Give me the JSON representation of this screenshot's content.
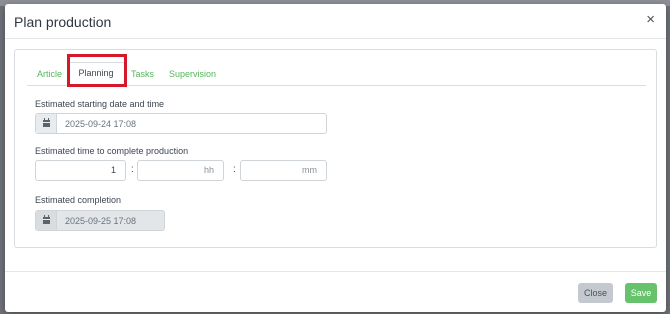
{
  "modal": {
    "title": "Plan production",
    "close_glyph": "×"
  },
  "tabs": [
    {
      "label": "Article",
      "active": false
    },
    {
      "label": "Planning",
      "active": true
    },
    {
      "label": "Tasks",
      "active": false
    },
    {
      "label": "Supervision",
      "active": false
    }
  ],
  "form": {
    "start": {
      "label": "Estimated starting date and time",
      "value": "2025-09-24 17:08",
      "icon": "calendar-icon"
    },
    "duration": {
      "label": "Estimated time to complete production",
      "days_value": "1",
      "hours_placeholder": "hh",
      "minutes_placeholder": "mm",
      "separator": ":"
    },
    "completion": {
      "label": "Estimated completion",
      "value": "2025-09-25 17:08",
      "icon": "calendar-icon",
      "disabled": true
    }
  },
  "footer": {
    "close_label": "Close",
    "save_label": "Save"
  },
  "colors": {
    "accent": "#67c26c",
    "tab_link": "#55b65a",
    "highlight": "#d6182b",
    "overlay": "#6f7379"
  }
}
